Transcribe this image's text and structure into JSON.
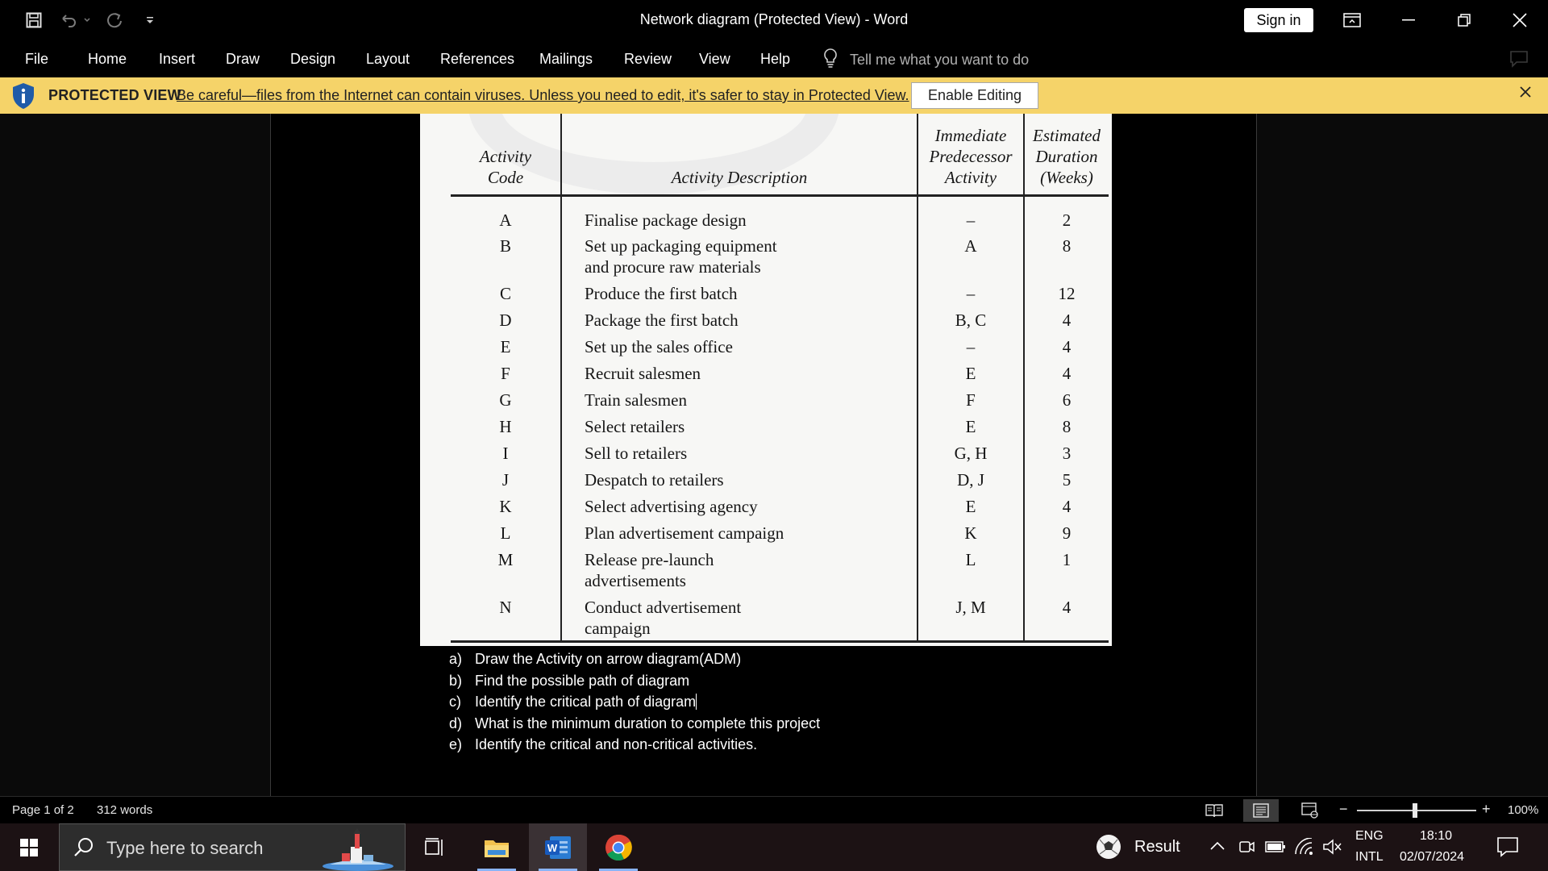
{
  "window": {
    "title": "Network diagram (Protected View)  -  Word",
    "sign_in": "Sign in"
  },
  "menu": {
    "items": [
      "File",
      "Home",
      "Insert",
      "Draw",
      "Design",
      "Layout",
      "References",
      "Mailings",
      "Review",
      "View",
      "Help"
    ],
    "tell_me": "Tell me what you want to do"
  },
  "protected_view": {
    "title": "PROTECTED VIEW",
    "message": "Be careful—files from the Internet can contain viruses. Unless you need to edit, it's safer to stay in Protected View.",
    "enable_button": "Enable Editing"
  },
  "table": {
    "headers": {
      "code": [
        "Activity",
        "Code"
      ],
      "description": [
        "Activity Description"
      ],
      "predecessor": [
        "Immediate",
        "Predecessor",
        "Activity"
      ],
      "duration": [
        "Estimated",
        "Duration",
        "(Weeks)"
      ]
    },
    "rows": [
      {
        "code": "A",
        "desc": [
          "Finalise package design"
        ],
        "pred": "–",
        "dur": "2"
      },
      {
        "code": "B",
        "desc": [
          "Set up packaging equipment",
          "and procure raw materials"
        ],
        "pred": "A",
        "dur": "8"
      },
      {
        "code": "C",
        "desc": [
          "Produce the first batch"
        ],
        "pred": "–",
        "dur": "12"
      },
      {
        "code": "D",
        "desc": [
          "Package the first batch"
        ],
        "pred": "B, C",
        "dur": "4"
      },
      {
        "code": "E",
        "desc": [
          "Set up the sales office"
        ],
        "pred": "–",
        "dur": "4"
      },
      {
        "code": "F",
        "desc": [
          "Recruit salesmen"
        ],
        "pred": "E",
        "dur": "4"
      },
      {
        "code": "G",
        "desc": [
          "Train salesmen"
        ],
        "pred": "F",
        "dur": "6"
      },
      {
        "code": "H",
        "desc": [
          "Select retailers"
        ],
        "pred": "E",
        "dur": "8"
      },
      {
        "code": "I",
        "desc": [
          "Sell to retailers"
        ],
        "pred": "G, H",
        "dur": "3"
      },
      {
        "code": "J",
        "desc": [
          "Despatch to retailers"
        ],
        "pred": "D, J",
        "dur": "5"
      },
      {
        "code": "K",
        "desc": [
          "Select advertising agency"
        ],
        "pred": "E",
        "dur": "4"
      },
      {
        "code": "L",
        "desc": [
          "Plan advertisement campaign"
        ],
        "pred": "K",
        "dur": "9"
      },
      {
        "code": "M",
        "desc": [
          "Release pre-launch",
          "advertisements"
        ],
        "pred": "L",
        "dur": "1"
      },
      {
        "code": "N",
        "desc": [
          "Conduct advertisement",
          "campaign"
        ],
        "pred": "J, M",
        "dur": "4"
      }
    ]
  },
  "questions": [
    {
      "label": "a)",
      "text": "Draw the Activity on arrow diagram(ADM)"
    },
    {
      "label": "b)",
      "text": "Find the possible path of diagram"
    },
    {
      "label": "c)",
      "text": "Identify the critical path of diagram"
    },
    {
      "label": "d)",
      "text": "What is the minimum duration to complete this project"
    },
    {
      "label": "e)",
      "text": "Identify the critical and non-critical activities."
    }
  ],
  "status": {
    "page": "Page 1 of 2",
    "words": "312 words",
    "zoom": "100%",
    "zoom_minus": "−",
    "zoom_plus": "+"
  },
  "taskbar": {
    "search_placeholder": "Type here to search",
    "weather": "Result",
    "lang_top": "ENG",
    "lang_bottom": "INTL",
    "time": "18:10",
    "date": "02/07/2024"
  },
  "colors": {
    "protected_bar": "#f5d369",
    "word_blue": "#185abd",
    "shield_blue": "#1f5ba8"
  }
}
